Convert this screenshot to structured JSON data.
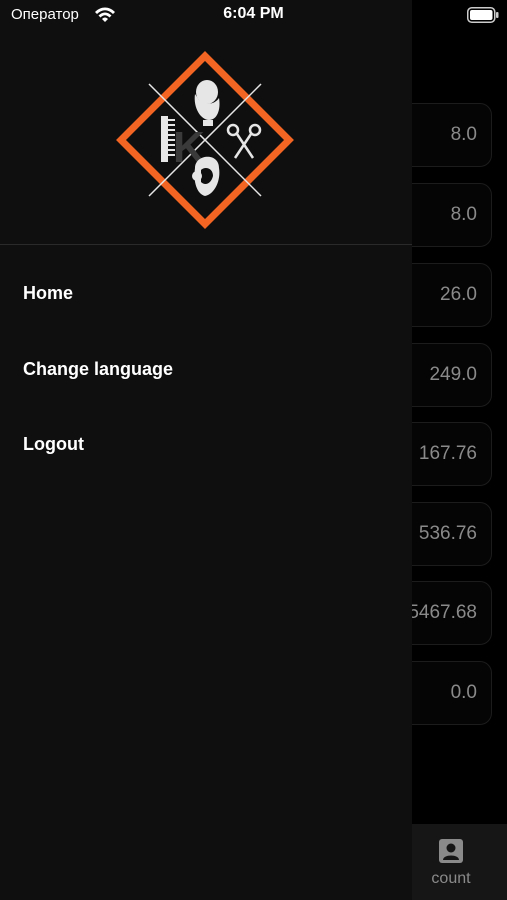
{
  "status_bar": {
    "carrier": "Оператор",
    "time": "6:04 PM"
  },
  "drawer": {
    "menu": [
      {
        "label": "Home"
      },
      {
        "label": "Change language"
      },
      {
        "label": "Logout"
      }
    ]
  },
  "background": {
    "values": [
      "8.0",
      "8.0",
      "26.0",
      "249.0",
      "167.76",
      "536.76",
      "5467.68",
      "0.0"
    ],
    "bottom_tab_label": "count"
  },
  "colors": {
    "accent": "#f26522",
    "drawer_bg": "#0f0f0f",
    "text_muted": "#8a8a8a"
  }
}
